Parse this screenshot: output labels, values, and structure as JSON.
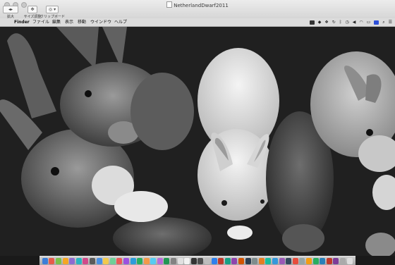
{
  "window": {
    "title": "NetherlandDwarf2011",
    "toolbar": {
      "zoom_label": "拡大",
      "resize_label": "サイズ調整",
      "clipboard_label": "クリップボード"
    }
  },
  "menubar": {
    "apple_symbol": "",
    "items": [
      "Finder",
      "ファイル",
      "編集",
      "表示",
      "移動",
      "ウインドウ",
      "ヘルプ"
    ]
  },
  "photo": {
    "subject": "rabbits",
    "tone": "monochrome"
  },
  "dock": {
    "icon_colors": [
      "#3b7dd8",
      "#e85b4a",
      "#7bc04a",
      "#f5a623",
      "#8e6bd1",
      "#2bb3c0",
      "#d04a8a",
      "#5a5a5a",
      "#4a90e2",
      "#f2c94c",
      "#6fcf97",
      "#eb5757",
      "#9b51e0",
      "#2d9cdb",
      "#27ae60",
      "#f2994a",
      "#56ccf2",
      "#bb6bd9",
      "#219653",
      "#828282",
      "#e0e0e0",
      "#f2f2f2",
      "#333333",
      "#4f4f4f",
      "#bdbdbd",
      "#2f80ed",
      "#c0392b",
      "#16a085",
      "#8e44ad",
      "#d35400",
      "#2c3e50",
      "#7f8c8d",
      "#e67e22",
      "#1abc9c",
      "#3498db",
      "#9b59b6",
      "#34495e",
      "#e74c3c",
      "#95a5a6",
      "#f39c12",
      "#27ae60",
      "#2980b9",
      "#c0392b",
      "#7d3c98",
      "#aaaaaa",
      "#dddddd"
    ]
  }
}
